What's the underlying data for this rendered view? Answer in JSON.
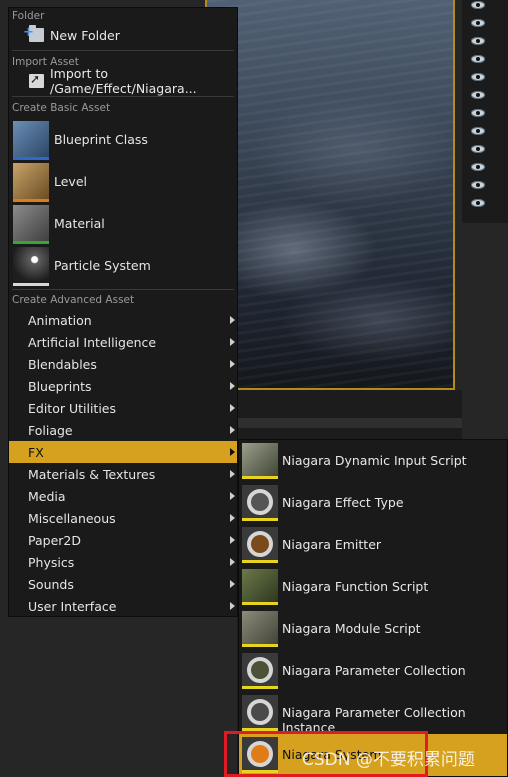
{
  "menu": {
    "folder_header": "Folder",
    "new_folder": "New Folder",
    "import_header": "Import Asset",
    "import_item": "Import to /Game/Effect/Niagara...",
    "basic_header": "Create Basic Asset",
    "basic_assets": [
      {
        "label": "Blueprint Class",
        "icon": "blueprint-icon",
        "stripe": "#2e6ac9"
      },
      {
        "label": "Level",
        "icon": "level-icon",
        "stripe": "#e07c18"
      },
      {
        "label": "Material",
        "icon": "material-icon",
        "stripe": "#3aa33a"
      },
      {
        "label": "Particle System",
        "icon": "particle-system-icon",
        "stripe": "#d8d8d8"
      }
    ],
    "advanced_header": "Create Advanced Asset",
    "advanced_items": [
      "Animation",
      "Artificial Intelligence",
      "Blendables",
      "Blueprints",
      "Editor Utilities",
      "Foliage",
      "FX",
      "Materials & Textures",
      "Media",
      "Miscellaneous",
      "Paper2D",
      "Physics",
      "Sounds",
      "User Interface"
    ],
    "active_item": "FX"
  },
  "fx_submenu": {
    "items": [
      {
        "label": "Niagara Dynamic Input Script",
        "icon": "niagara-dynamic-input-script-icon"
      },
      {
        "label": "Niagara Effect Type",
        "icon": "niagara-effect-type-icon"
      },
      {
        "label": "Niagara Emitter",
        "icon": "niagara-emitter-icon"
      },
      {
        "label": "Niagara Function Script",
        "icon": "niagara-function-script-icon"
      },
      {
        "label": "Niagara Module Script",
        "icon": "niagara-module-script-icon"
      },
      {
        "label": "Niagara Parameter Collection",
        "icon": "niagara-parameter-collection-icon"
      },
      {
        "label": "Niagara Parameter Collection Instance",
        "icon": "niagara-parameter-collection-instance-icon"
      },
      {
        "label": "Niagara System",
        "icon": "niagara-system-icon"
      }
    ],
    "active_item": "Niagara System"
  },
  "watermark": "CSDN @不要积累问题",
  "colors": {
    "accent": "#d7a120",
    "highlight_box": "#e01b24",
    "menu_bg": "#1a1a1a"
  }
}
